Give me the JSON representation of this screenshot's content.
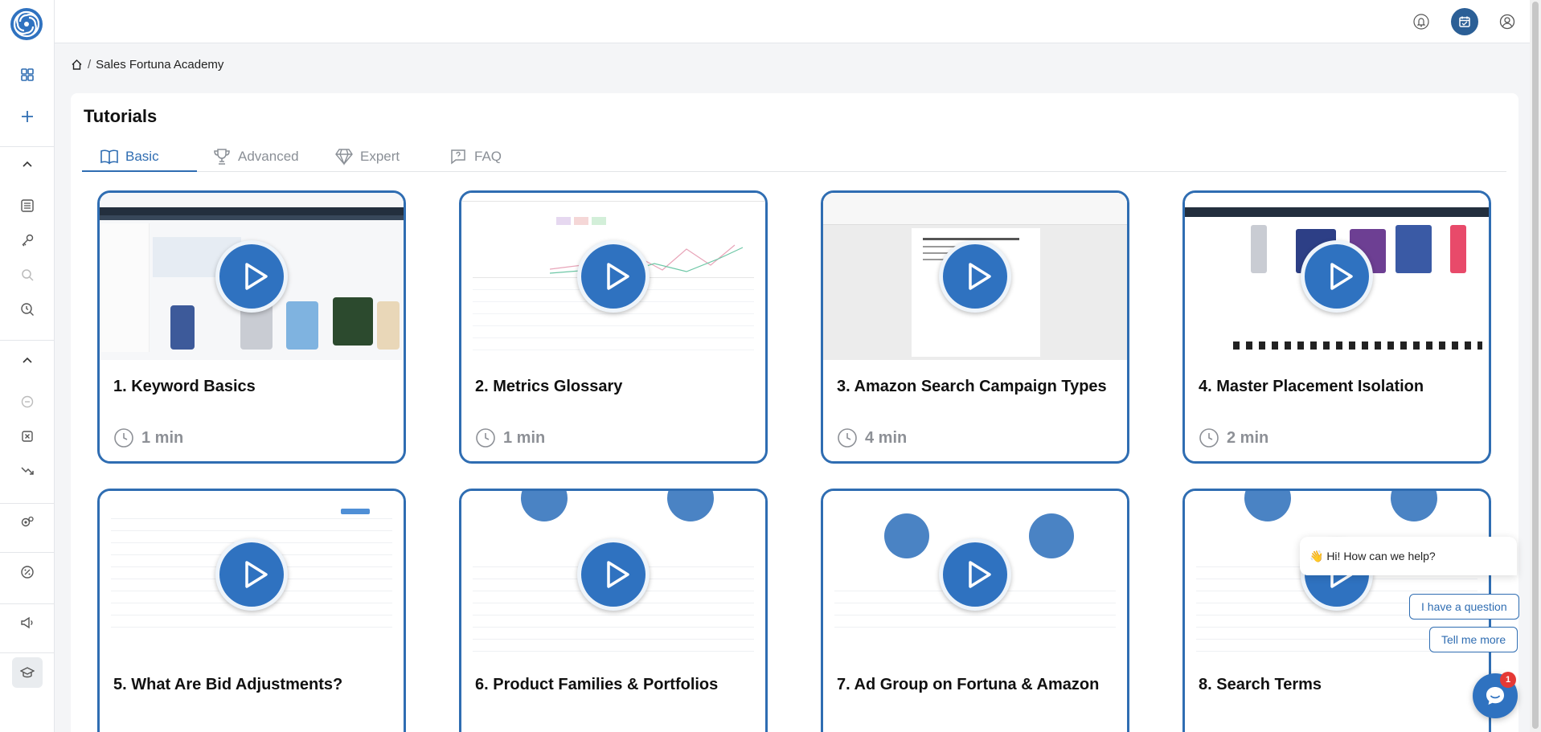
{
  "breadcrumb": {
    "current": "Sales Fortuna Academy",
    "separator": "/"
  },
  "page": {
    "title": "Tutorials"
  },
  "tabs": [
    {
      "label": "Basic",
      "icon": "book-icon",
      "active": true
    },
    {
      "label": "Advanced",
      "icon": "trophy-icon",
      "active": false
    },
    {
      "label": "Expert",
      "icon": "diamond-icon",
      "active": false
    },
    {
      "label": "FAQ",
      "icon": "question-icon",
      "active": false
    }
  ],
  "cards": [
    {
      "title": "1. Keyword Basics",
      "duration": "1 min"
    },
    {
      "title": "2. Metrics Glossary",
      "duration": "1 min"
    },
    {
      "title": "3. Amazon Search Campaign Types",
      "duration": "4 min"
    },
    {
      "title": "4. Master Placement Isolation",
      "duration": "2 min"
    },
    {
      "title": "5. What Are Bid Adjustments?",
      "duration": ""
    },
    {
      "title": "6. Product Families & Portfolios",
      "duration": ""
    },
    {
      "title": "7. Ad Group on Fortuna & Amazon",
      "duration": ""
    },
    {
      "title": "8. Search Terms",
      "duration": ""
    }
  ],
  "chat": {
    "greeting": "👋 Hi! How can we help?",
    "options": [
      "I have a question",
      "Tell me more"
    ],
    "badge": "1"
  },
  "colors": {
    "accent": "#2f6db2",
    "play": "#2f72c0",
    "muted": "#8d9096"
  }
}
